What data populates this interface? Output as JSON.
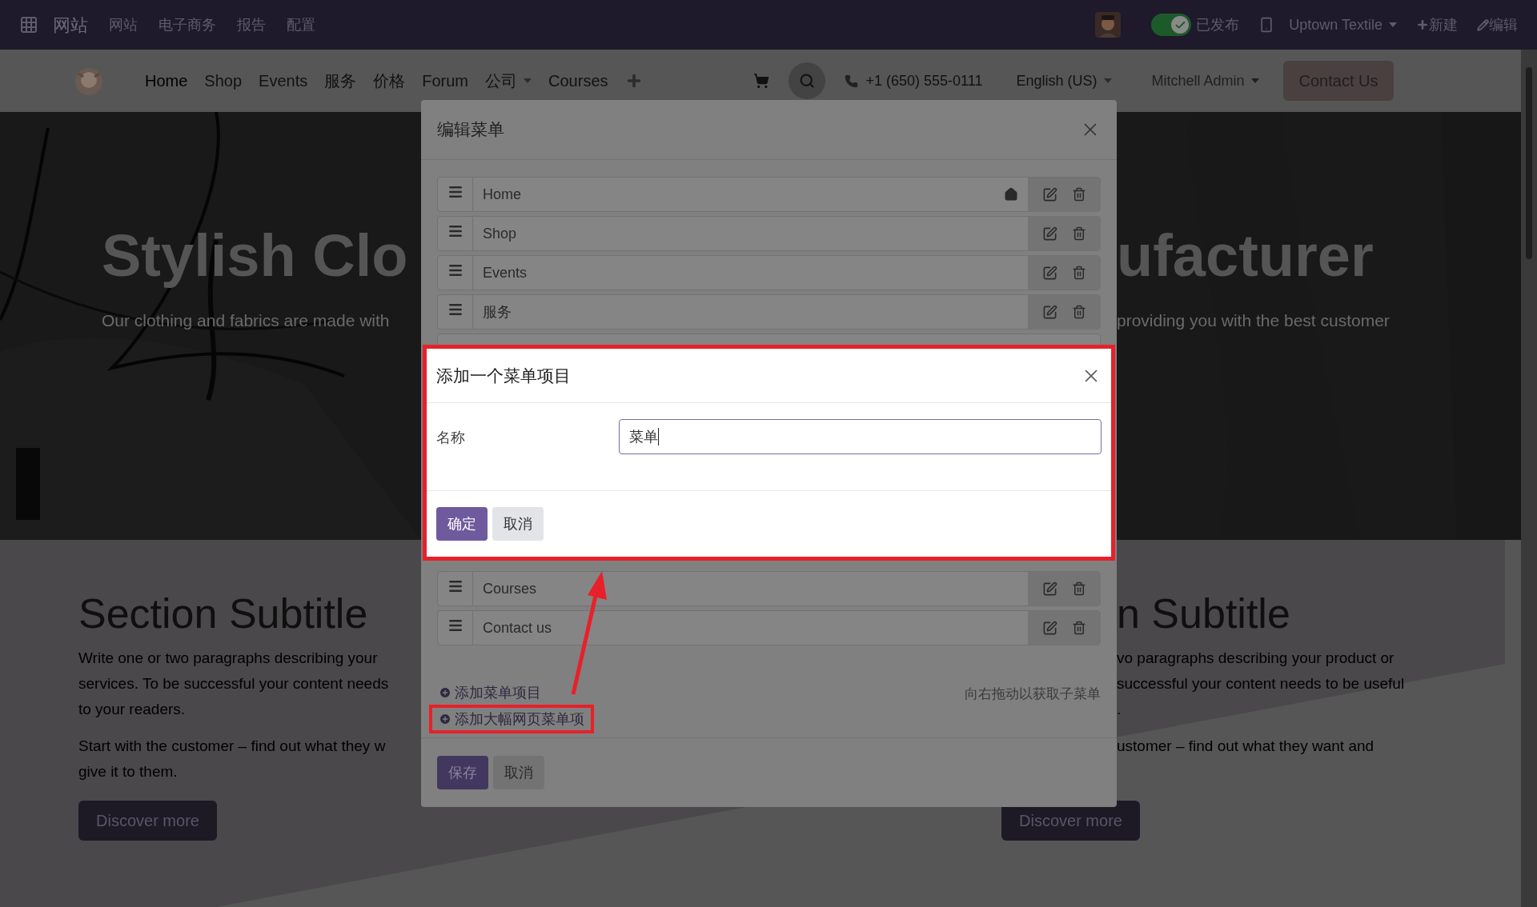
{
  "top_bar": {
    "app_title": "网站",
    "menus": [
      "网站",
      "电子商务",
      "报告",
      "配置"
    ],
    "published": {
      "on": true,
      "label": "已发布"
    },
    "website": "Uptown Textile",
    "new_label": "新建",
    "edit_label": "编辑"
  },
  "navbar": {
    "items": [
      {
        "label": "Home",
        "selected": true,
        "kind": "link"
      },
      {
        "label": "Shop",
        "selected": false,
        "kind": "link"
      },
      {
        "label": "Events",
        "selected": false,
        "kind": "link"
      },
      {
        "label": "服务",
        "selected": false,
        "kind": "link"
      },
      {
        "label": "价格",
        "selected": false,
        "kind": "link"
      },
      {
        "label": "Forum",
        "selected": false,
        "kind": "link"
      },
      {
        "label": "公司",
        "selected": false,
        "kind": "dropdown"
      },
      {
        "label": "Courses",
        "selected": false,
        "kind": "link"
      }
    ],
    "phone": "+1 (650) 555-0111",
    "language": "English (US)",
    "user": "Mitchell Admin",
    "cta": "Contact Us"
  },
  "hero": {
    "title_left": "Stylish Clo",
    "title_right": "ufacturer",
    "subtitle_left": "Our clothing and fabrics are made with",
    "subtitle_right": "providing you with the best customer"
  },
  "sections": {
    "left": {
      "title": "Section Subtitle",
      "paragraphs": [
        [
          "Write one or two paragraphs describing your",
          "services. To be successful your content needs",
          "to your readers."
        ],
        [
          "Start with the customer – find out what they w",
          "give it to them."
        ]
      ],
      "button": "Discover more"
    },
    "right": {
      "title": "n Subtitle",
      "paragraphs": [
        [
          "vo paragraphs describing your product or",
          "successful your content needs to be useful",
          "."
        ],
        [
          "ustomer – find out what they want and"
        ]
      ],
      "button": "Discover more"
    }
  },
  "edit_menu_dialog": {
    "title": "编辑菜单",
    "items": [
      {
        "label": "Home",
        "home": true
      },
      {
        "label": "Shop",
        "home": false
      },
      {
        "label": "Events",
        "home": false
      },
      {
        "label": "服务",
        "home": false
      }
    ],
    "items_below": [
      {
        "label": "Courses",
        "home": false
      },
      {
        "label": "Contact us",
        "home": false
      }
    ],
    "links": [
      {
        "label": "添加菜单项目",
        "highlighted": false
      },
      {
        "label": "添加大幅网页菜单项",
        "highlighted": true
      }
    ],
    "hint": "向右拖动以获取子菜单",
    "buttons": [
      {
        "label": "保存",
        "kind": "primary"
      },
      {
        "label": "取消",
        "kind": "secondary"
      }
    ]
  },
  "add_item_dialog": {
    "title": "添加一个菜单项目",
    "field_label": "名称",
    "value": "菜单",
    "buttons": [
      {
        "label": "确定",
        "kind": "primary"
      },
      {
        "label": "取消",
        "kind": "secondary"
      }
    ]
  }
}
